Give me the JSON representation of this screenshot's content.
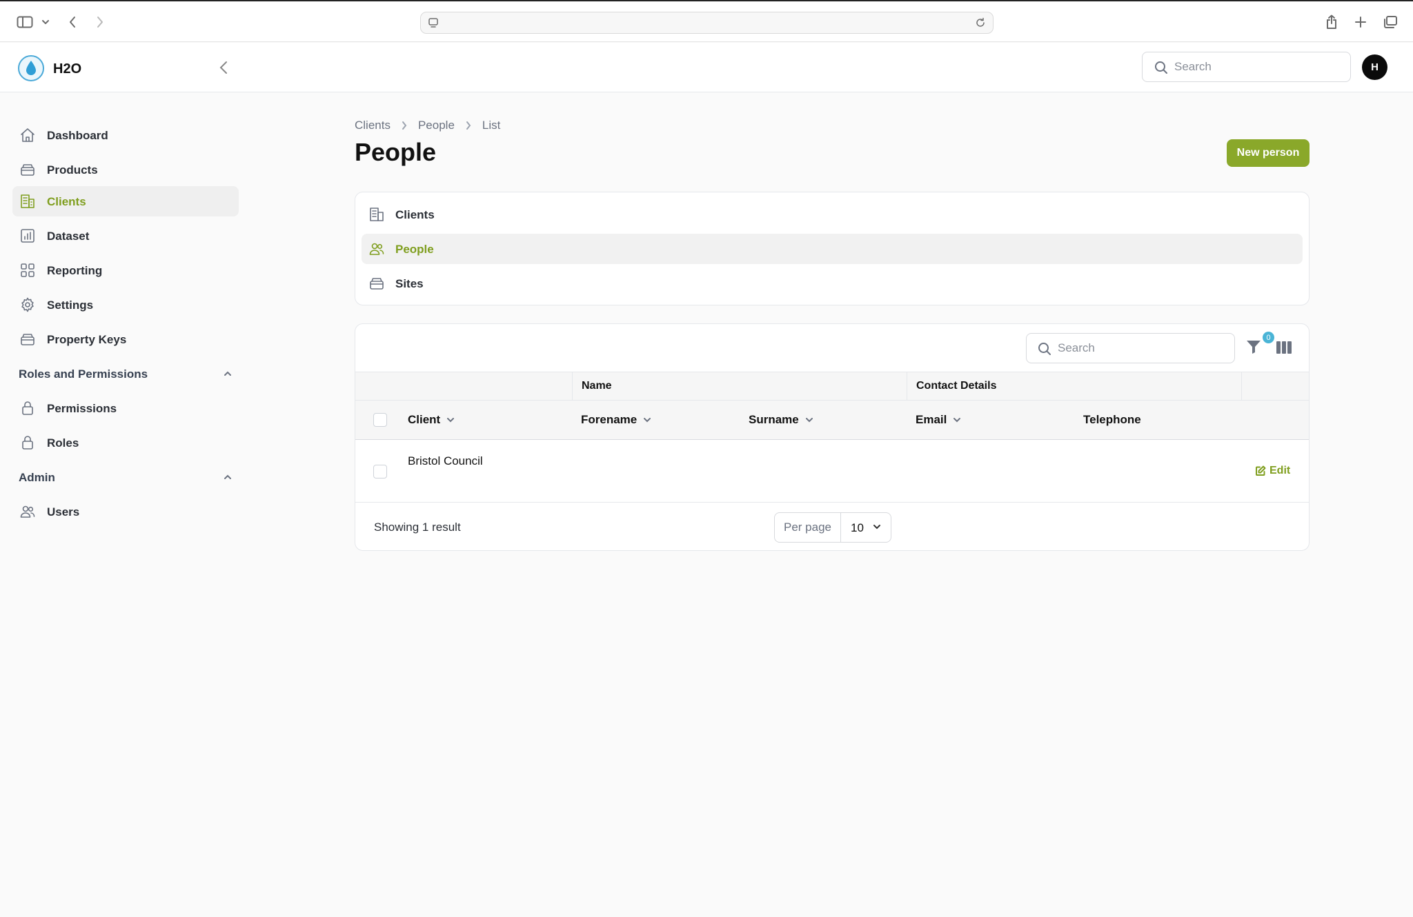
{
  "app": {
    "name": "H2O",
    "avatar_initial": "H"
  },
  "header": {
    "search_placeholder": "Search"
  },
  "sidebar": {
    "items": [
      {
        "label": "Dashboard",
        "icon": "home-icon"
      },
      {
        "label": "Products",
        "icon": "box-icon"
      },
      {
        "label": "Clients",
        "icon": "building-icon",
        "active": true
      },
      {
        "label": "Dataset",
        "icon": "chart-icon"
      },
      {
        "label": "Reporting",
        "icon": "grid-icon"
      },
      {
        "label": "Settings",
        "icon": "gear-icon"
      },
      {
        "label": "Property Keys",
        "icon": "box-icon"
      }
    ],
    "groups": [
      {
        "label": "Roles and Permissions",
        "items": [
          {
            "label": "Permissions",
            "icon": "lock-icon"
          },
          {
            "label": "Roles",
            "icon": "lock-icon"
          }
        ]
      },
      {
        "label": "Admin",
        "items": [
          {
            "label": "Users",
            "icon": "users-icon"
          }
        ]
      }
    ]
  },
  "breadcrumb": [
    "Clients",
    "People",
    "List"
  ],
  "page": {
    "title": "People",
    "new_button": "New person"
  },
  "subnav": [
    {
      "label": "Clients",
      "icon": "building-icon"
    },
    {
      "label": "People",
      "icon": "users-icon",
      "active": true
    },
    {
      "label": "Sites",
      "icon": "box-icon"
    }
  ],
  "table": {
    "search_placeholder": "Search",
    "filter_count": "0",
    "column_groups": [
      "Name",
      "Contact Details"
    ],
    "columns": [
      "Client",
      "Forename",
      "Surname",
      "Email",
      "Telephone"
    ],
    "rows": [
      {
        "client": "Bristol Council",
        "forename": "",
        "surname": "",
        "email": "",
        "telephone": ""
      }
    ],
    "row_action": "Edit",
    "result_text": "Showing 1 result",
    "per_page_label": "Per page",
    "per_page_value": "10"
  },
  "colors": {
    "accent": "#8aa82a",
    "accent_text": "#7f9e1e",
    "badge": "#4ab4d6",
    "logo": "#4aa9d8"
  }
}
